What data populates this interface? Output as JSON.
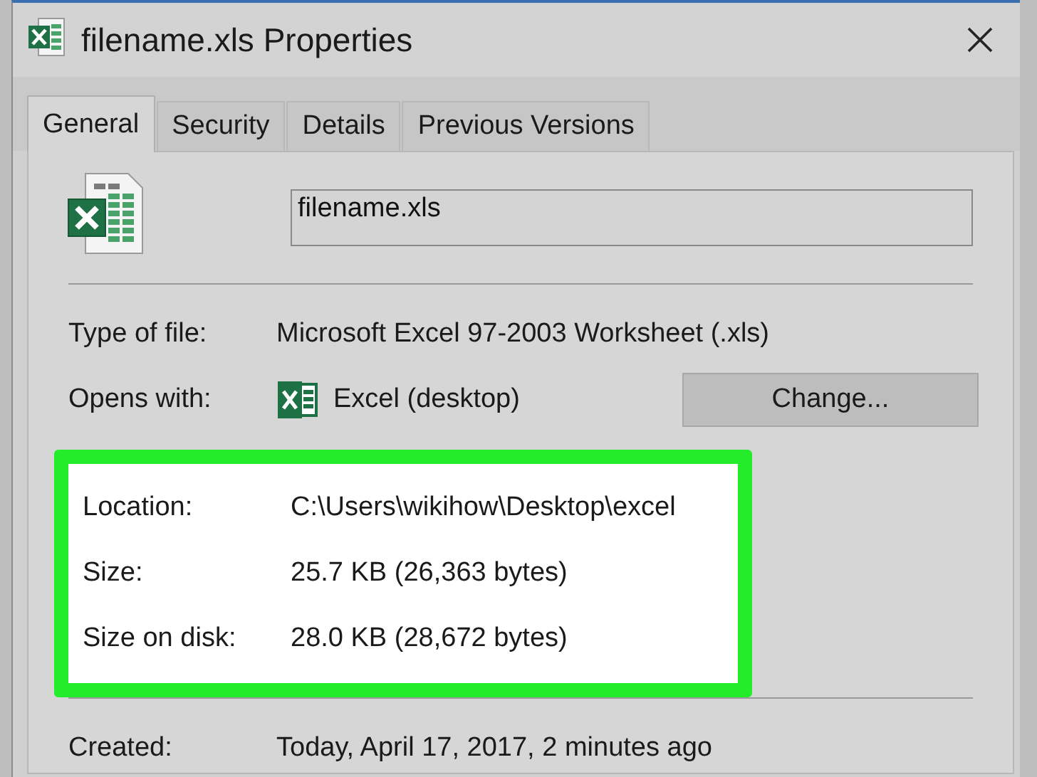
{
  "window": {
    "title": "filename.xls Properties"
  },
  "tabs": [
    {
      "label": "General",
      "selected": true
    },
    {
      "label": "Security",
      "selected": false
    },
    {
      "label": "Details",
      "selected": false
    },
    {
      "label": "Previous Versions",
      "selected": false
    }
  ],
  "file_name": {
    "value": "filename.xls"
  },
  "type_rows": [
    {
      "label": "Type of file:",
      "value": "Microsoft Excel 97-2003 Worksheet (.xls)"
    }
  ],
  "opens_with": {
    "label": "Opens with:",
    "value": "Excel (desktop)",
    "button": "Change..."
  },
  "location_section": {
    "highlighted": true,
    "rows": [
      {
        "label": "Location:",
        "value": "C:\\Users\\wikihow\\Desktop\\excel"
      },
      {
        "label": "Size:",
        "value": "25.7 KB (26,363 bytes)"
      },
      {
        "label": "Size on disk:",
        "value": "28.0 KB (28,672 bytes)"
      }
    ]
  },
  "date_rows": [
    {
      "label": "Created:",
      "value": "Today, April 17, 2017, 2 minutes ago"
    }
  ]
}
